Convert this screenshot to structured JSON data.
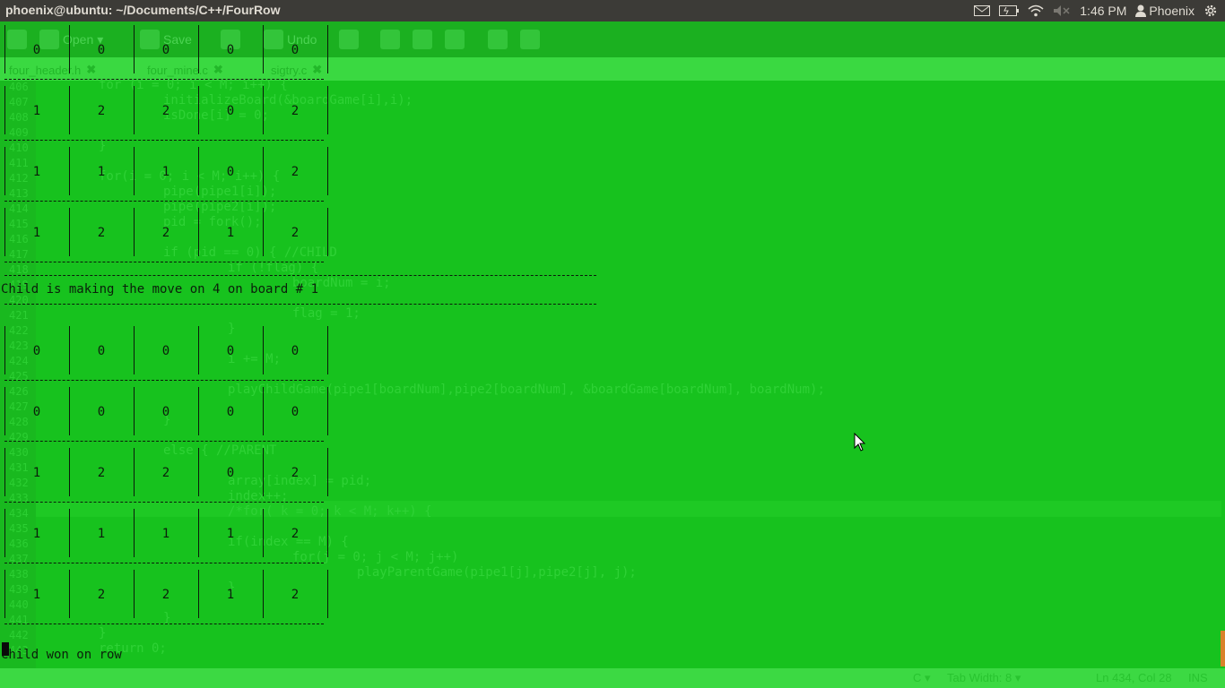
{
  "panel": {
    "title": "phoenix@ubuntu: ~/Documents/C++/FourRow",
    "time": "1:46 PM",
    "user": "Phoenix",
    "icons": [
      "mail-icon",
      "battery-icon",
      "wifi-icon",
      "volume-muted-icon",
      "user-icon",
      "gear-icon"
    ]
  },
  "editor": {
    "toolbar": {
      "open_label": "Open",
      "save_label": "Save",
      "undo_label": "Undo"
    },
    "tabs": [
      {
        "label": "four_header.h"
      },
      {
        "label": "four_mine.c"
      },
      {
        "label": "sigtry.c"
      }
    ],
    "line_numbers": [
      "406",
      "407",
      "408",
      "409",
      "410",
      "411",
      "412",
      "413",
      "414",
      "415",
      "416",
      "417",
      "418",
      "419",
      "420",
      "421",
      "422",
      "423",
      "424",
      "425",
      "426",
      "427",
      "428",
      "429",
      "430",
      "431",
      "432",
      "433",
      "434",
      "435",
      "436",
      "437",
      "438",
      "439",
      "440",
      "441",
      "442",
      "443"
    ],
    "code": [
      "for (i = 0; i < M; i++) {",
      "    initializeBoard(&boardGame[i],i);",
      "    isDone[i] = 0;",
      "}",
      "for(i = 0; i < M; i++) {",
      "    pipe(pipe1[i]);",
      "    pipe(pipe2[i]);",
      "    pid = fork();",
      "    if (pid == 0) { //CHILD",
      "        if (!flag) {",
      "            boardNum = i;",
      "            flag = 1;",
      "        }",
      "        i += M;",
      "        playChildGame(pipe1[boardNum],pipe2[boardNum], &boardGame[boardNum], boardNum);",
      "    }",
      "    else { //PARENT",
      "        array[index] = pid;",
      "        index++;",
      "        /*for( k = 0; k < M; k++) {",
      "        if(index == M) {",
      "            for(j = 0; j < M; j++)",
      "                playParentGame(pipe1[j],pipe2[j], j);",
      "        }",
      "    }",
      "}",
      "return 0;"
    ],
    "status": {
      "language": "C",
      "tab_width": "Tab Width: 8",
      "position": "Ln 434, Col 28",
      "mode": "INS"
    }
  },
  "terminal": {
    "board1": [
      [
        "0",
        "0",
        "0",
        "0",
        "0"
      ],
      [
        "1",
        "2",
        "2",
        "0",
        "2"
      ],
      [
        "1",
        "1",
        "1",
        "0",
        "2"
      ],
      [
        "1",
        "2",
        "2",
        "1",
        "2"
      ]
    ],
    "message1": "Child is making the move on 4 on board # 1",
    "board2": [
      [
        "0",
        "0",
        "0",
        "0",
        "0"
      ],
      [
        "0",
        "0",
        "0",
        "0",
        "0"
      ],
      [
        "1",
        "2",
        "2",
        "0",
        "2"
      ],
      [
        "1",
        "1",
        "1",
        "1",
        "2"
      ],
      [
        "1",
        "2",
        "2",
        "1",
        "2"
      ]
    ],
    "message2": "Child won on row"
  }
}
